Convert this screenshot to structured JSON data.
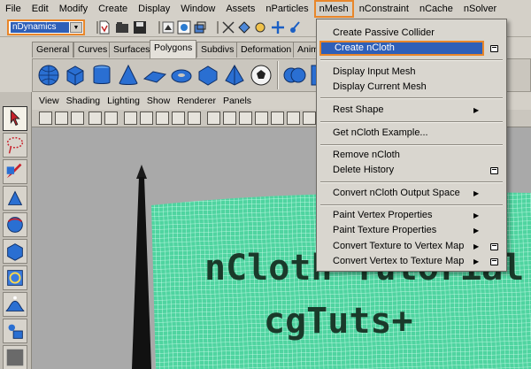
{
  "menubar": {
    "items": [
      "File",
      "Edit",
      "Modify",
      "Create",
      "Display",
      "Window",
      "Assets",
      "nParticles",
      "nMesh",
      "nConstraint",
      "nCache",
      "nSolver"
    ],
    "active": "nMesh"
  },
  "statusline": {
    "mode_value": "nDynamics"
  },
  "shelf": {
    "tabs": [
      "General",
      "Curves",
      "Surfaces",
      "Polygons",
      "Subdivs",
      "Deformation",
      "Anim"
    ],
    "active_tab": "Polygons"
  },
  "panel": {
    "menus": [
      "View",
      "Shading",
      "Lighting",
      "Show",
      "Renderer",
      "Panels"
    ]
  },
  "viewport": {
    "cloth_text_line1": "nCloth Tutorial",
    "cloth_text_line2": "cgTuts+",
    "cloth_color": "#4fd4a0",
    "background_color": "#a9a9a9"
  },
  "nmesh_menu": {
    "items": [
      {
        "label": "Create Passive Collider",
        "submenu": false,
        "options": false
      },
      {
        "label": "Create nCloth",
        "submenu": false,
        "options": true,
        "highlighted": true
      },
      {
        "separator": true
      },
      {
        "label": "Display Input Mesh",
        "submenu": false,
        "options": false
      },
      {
        "label": "Display Current Mesh",
        "submenu": false,
        "options": false
      },
      {
        "separator": true
      },
      {
        "label": "Rest Shape",
        "submenu": true,
        "options": false
      },
      {
        "separator": true
      },
      {
        "label": "Get nCloth Example...",
        "submenu": false,
        "options": false
      },
      {
        "separator": true
      },
      {
        "label": "Remove nCloth",
        "submenu": false,
        "options": false
      },
      {
        "label": "Delete History",
        "submenu": false,
        "options": true
      },
      {
        "separator": true
      },
      {
        "label": "Convert nCloth Output Space",
        "submenu": true,
        "options": false
      },
      {
        "separator": true
      },
      {
        "label": "Paint Vertex Properties",
        "submenu": true,
        "options": false
      },
      {
        "label": "Paint Texture Properties",
        "submenu": true,
        "options": false
      },
      {
        "label": "Convert Texture to Vertex Map",
        "submenu": true,
        "options": true
      },
      {
        "label": "Convert Vertex to Texture Map",
        "submenu": true,
        "options": true
      }
    ]
  },
  "colors": {
    "accent_highlight": "#e8862a",
    "selection_blue": "#2e5fb8"
  }
}
